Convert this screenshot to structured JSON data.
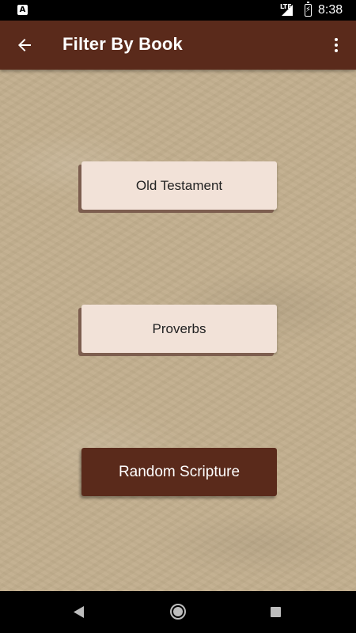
{
  "status_bar": {
    "left_icon_letter": "A",
    "network_label": "LTE",
    "time": "8:38",
    "icons": [
      "notification-a-icon",
      "signal-icon",
      "battery-charging-icon"
    ]
  },
  "app_bar": {
    "title": "Filter By Book",
    "back_icon": "arrow-back-icon",
    "menu_icon": "overflow-menu-icon"
  },
  "buttons": {
    "old_testament": "Old Testament",
    "proverbs": "Proverbs",
    "random_scripture": "Random Scripture"
  },
  "nav_bar": {
    "icons": [
      "back-triangle-icon",
      "home-circle-icon",
      "recents-square-icon"
    ]
  },
  "colors": {
    "primary": "#5a2a1b",
    "button_light": "#f2e2d8",
    "background": "#c2ae8e"
  }
}
